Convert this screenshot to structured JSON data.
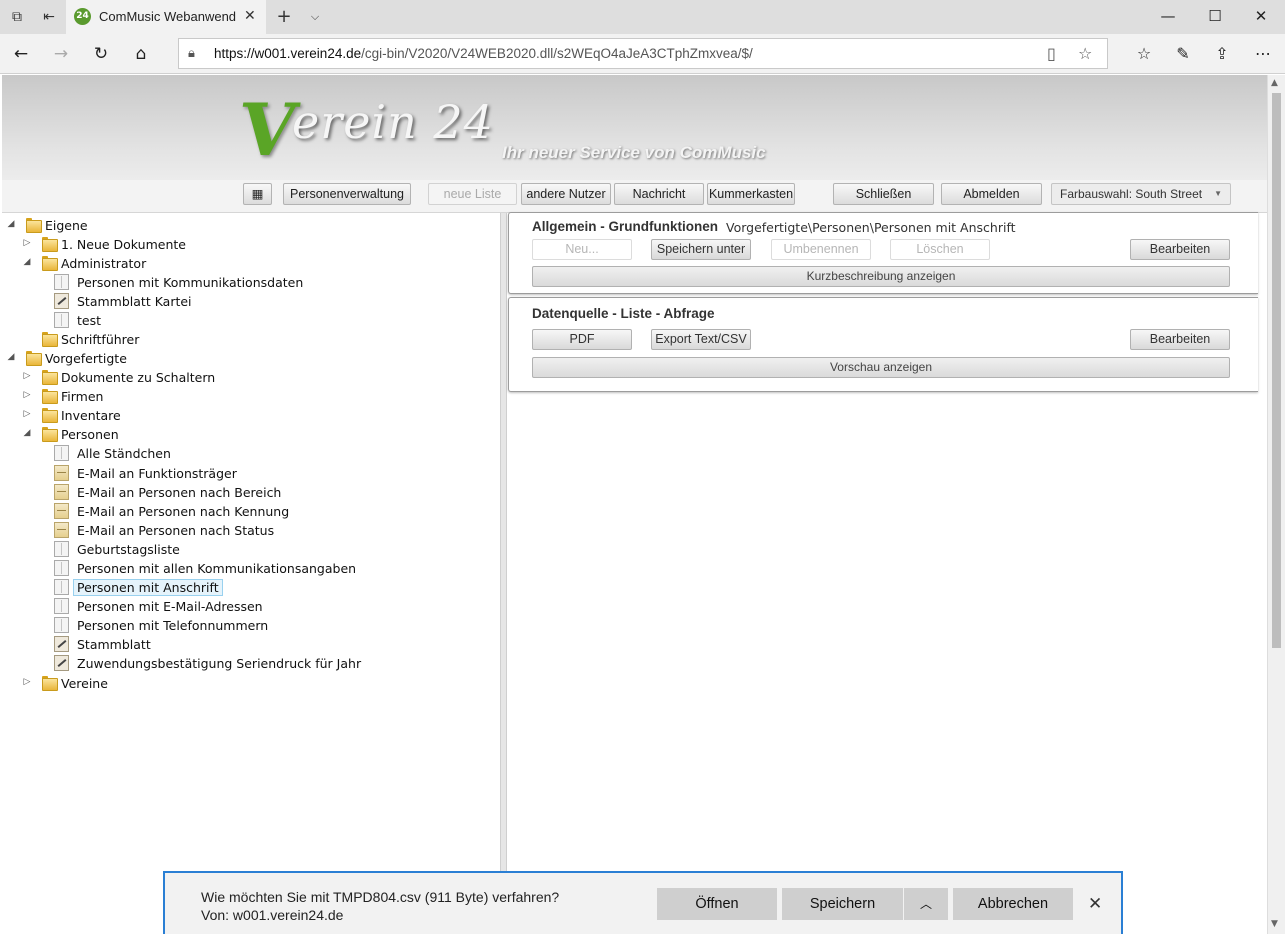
{
  "browser": {
    "tab_title": "ComMusic Webanwend",
    "favicon_text": "24",
    "url_host": "https://w001.verein24.de",
    "url_path": "/cgi-bin/V2020/V24WEB2020.dll/s2WEqO4aJeA3CTphZmxvea/$/",
    "icons": {
      "tab_actions": "tab-actions-icon",
      "tab_aside": "tab-aside-icon",
      "new_tab": "plus-icon",
      "tab_list": "chevron-down-icon",
      "back": "arrow-left-icon",
      "forward": "arrow-right-icon",
      "refresh": "refresh-icon",
      "home": "home-icon",
      "lock": "lock-icon",
      "reading": "reading-view-icon",
      "favorite": "star-icon",
      "favorites": "favorites-list-icon",
      "notes": "pen-icon",
      "share": "share-icon",
      "more": "more-icon",
      "minimize": "minimize-icon",
      "maximize": "maximize-icon",
      "close": "close-icon"
    }
  },
  "banner": {
    "logo_v": "V",
    "logo_rest": "erein 24",
    "slogan": "Ihr neuer Service von ComMusic"
  },
  "toolbar": {
    "menu_glyph": "▦",
    "personenverwaltung": "Personenverwaltung",
    "neue_liste": "neue Liste",
    "andere_nutzer": "andere Nutzer",
    "nachricht": "Nachricht",
    "kummerkasten": "Kummerkasten",
    "schliessen": "Schließen",
    "abmelden": "Abmelden",
    "farbauswahl": "Farbauswahl: South Street"
  },
  "tree": {
    "eigene": "Eigene",
    "neue_dokumente": "1. Neue Dokumente",
    "administrator": "Administrator",
    "admin_items": [
      "Personen mit Kommunikationsdaten",
      "Stammblatt Kartei",
      "test"
    ],
    "schriftfuehrer": "Schriftführer",
    "vorgefertigte": "Vorgefertigte",
    "dokumente_schaltern": "Dokumente zu Schaltern",
    "firmen": "Firmen",
    "inventare": "Inventare",
    "personen": "Personen",
    "personen_items": [
      "Alle Ständchen",
      "E-Mail an Funktionsträger",
      "E-Mail an Personen nach Bereich",
      "E-Mail an Personen nach Kennung",
      "E-Mail an Personen nach Status",
      "Geburtstagsliste",
      "Personen mit allen Kommunikationsangaben",
      "Personen mit Anschrift",
      "Personen mit E-Mail-Adressen",
      "Personen mit Telefonnummern",
      "Stammblatt",
      "Zuwendungsbestätigung Seriendruck für Jahr"
    ],
    "vereine": "Vereine",
    "selected": "Personen mit Anschrift"
  },
  "panel_allgemein": {
    "title": "Allgemein - Grundfunktionen",
    "path": "Vorgefertigte\\Personen\\Personen mit Anschrift",
    "neu": "Neu...",
    "speichern_unter": "Speichern unter",
    "umbenennen": "Umbenennen",
    "loeschen": "Löschen",
    "bearbeiten": "Bearbeiten",
    "kurzbeschreibung": "Kurzbeschreibung anzeigen"
  },
  "panel_datenquelle": {
    "title": "Datenquelle - Liste - Abfrage",
    "pdf": "PDF",
    "export": "Export Text/CSV",
    "bearbeiten": "Bearbeiten",
    "vorschau": "Vorschau anzeigen"
  },
  "download": {
    "question": "Wie möchten Sie mit TMPD804.csv (911 Byte) verfahren?",
    "from": "Von: w001.verein24.de",
    "open": "Öffnen",
    "save": "Speichern",
    "cancel": "Abbrechen"
  }
}
